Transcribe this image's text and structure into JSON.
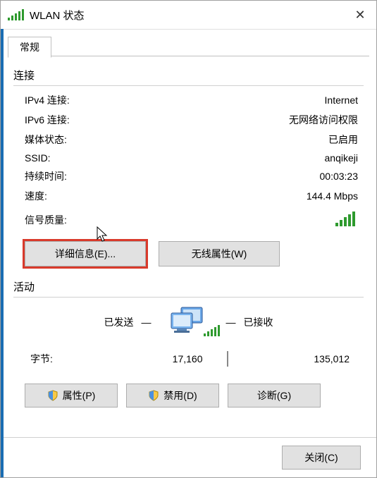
{
  "window_title": "WLAN 状态",
  "tab": "常规",
  "section_connection": "连接",
  "rows": {
    "ipv4_label": "IPv4 连接:",
    "ipv4_value": "Internet",
    "ipv6_label": "IPv6 连接:",
    "ipv6_value": "无网络访问权限",
    "media_label": "媒体状态:",
    "media_value": "已启用",
    "ssid_label": "SSID:",
    "ssid_value": "anqikeji",
    "duration_label": "持续时间:",
    "duration_value": "00:03:23",
    "speed_label": "速度:",
    "speed_value": "144.4 Mbps",
    "signal_label": "信号质量:"
  },
  "buttons": {
    "details": "详细信息(E)...",
    "wireless": "无线属性(W)",
    "properties": "属性(P)",
    "disable": "禁用(D)",
    "diagnose": "诊断(G)",
    "close": "关闭(C)"
  },
  "section_activity": "活动",
  "activity": {
    "sent_label": "已发送",
    "recv_label": "已接收",
    "bytes_label": "字节:",
    "bytes_sent": "17,160",
    "bytes_recv": "135,012"
  },
  "dash": "—"
}
